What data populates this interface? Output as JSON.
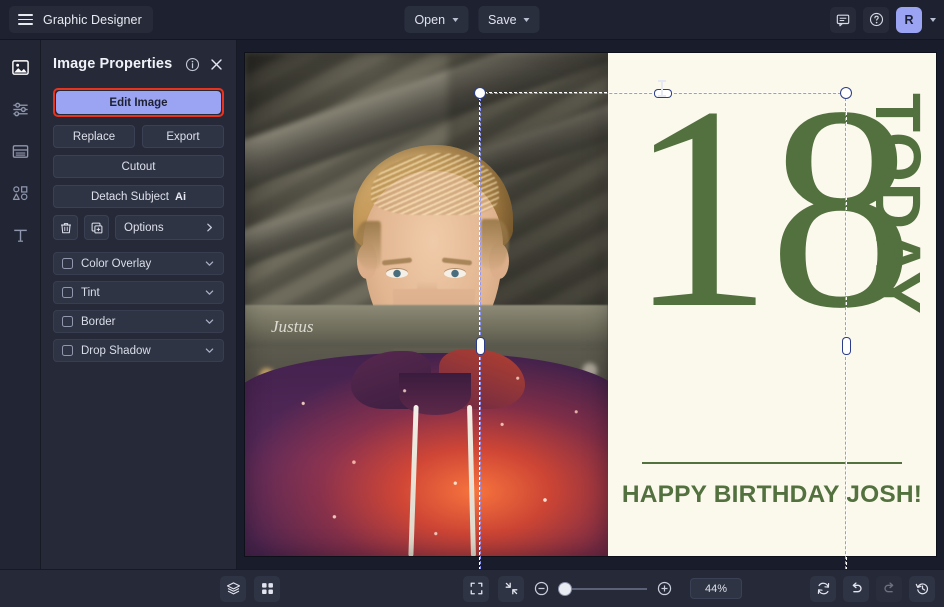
{
  "app": {
    "title": "Graphic Designer",
    "menu_icon": "hamburger-icon"
  },
  "topbar": {
    "open_label": "Open",
    "save_label": "Save",
    "comments_icon": "comment-icon",
    "help_icon": "help-circle-icon",
    "avatar_initial": "R"
  },
  "rail": {
    "items": [
      {
        "icon": "image-icon",
        "label": "Image",
        "active": true
      },
      {
        "icon": "adjustments-icon",
        "label": "Adjust",
        "active": false
      },
      {
        "icon": "layout-icon",
        "label": "Layout",
        "active": false
      },
      {
        "icon": "shapes-icon",
        "label": "Shapes",
        "active": false
      },
      {
        "icon": "text-icon",
        "label": "Text",
        "active": false
      }
    ]
  },
  "panel": {
    "title": "Image Properties",
    "info_icon": "info-circle-icon",
    "close_icon": "close-icon",
    "edit_image_label": "Edit Image",
    "replace_label": "Replace",
    "export_label": "Export",
    "cutout_label": "Cutout",
    "detach_subject_label": "Detach Subject",
    "detach_subject_badge": "Ai",
    "delete_icon": "trash-icon",
    "duplicate_icon": "duplicate-icon",
    "options_label": "Options",
    "options_chevron": "chevron-right-icon",
    "highlight_color": "#e8341f",
    "primary_color": "#9aa4f2",
    "effects": [
      {
        "label": "Color Overlay",
        "checked": false
      },
      {
        "label": "Tint",
        "checked": false
      },
      {
        "label": "Border",
        "checked": false
      },
      {
        "label": "Drop Shadow",
        "checked": false
      }
    ]
  },
  "canvas": {
    "selection_active": true,
    "artwork": {
      "number": "18",
      "today": "TODAY",
      "message": "HAPPY BIRTHDAY JOSH!",
      "accent_color": "#53703f",
      "paper_color": "#fbf8ec"
    },
    "photo": {
      "description": "Portrait of a teenage boy with blonde hair wearing a galaxy print hoodie",
      "graffiti_text": "Justus"
    }
  },
  "bottombar": {
    "layers_icon": "layers-icon",
    "grid_icon": "grid-icon",
    "fit_icon": "fit-screen-icon",
    "collapse_icon": "collapse-icon",
    "zoom_out_icon": "zoom-out-icon",
    "zoom_in_icon": "zoom-in-icon",
    "zoom_value": "44%",
    "refresh_icon": "refresh-icon",
    "undo_icon": "undo-icon",
    "redo_icon": "redo-icon",
    "history_icon": "history-icon"
  }
}
